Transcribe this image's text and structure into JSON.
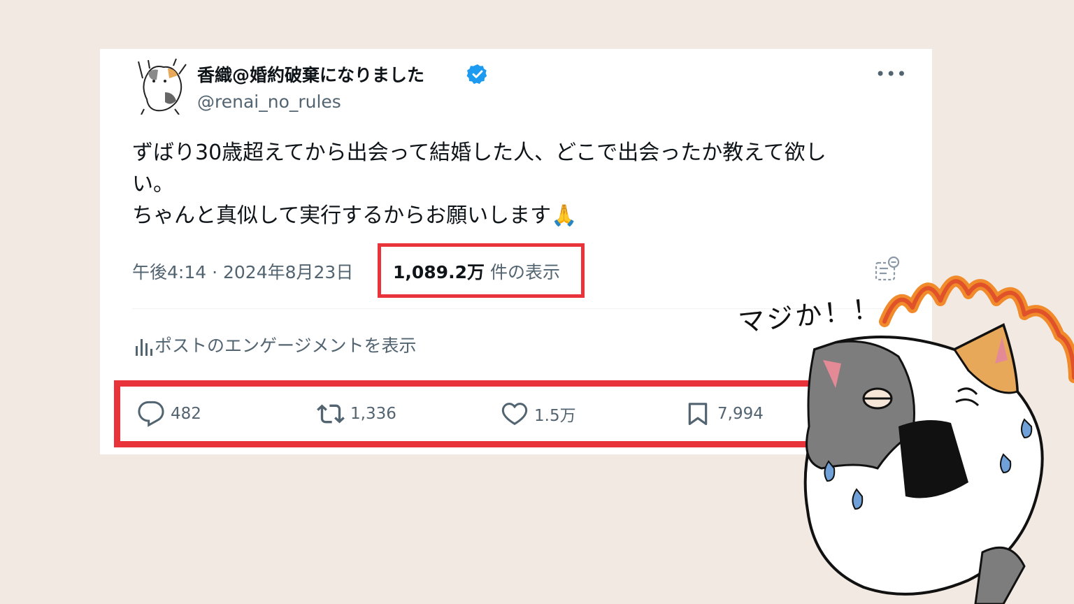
{
  "post": {
    "display_name": "香織@婚約破棄になりました",
    "handle": "@renai_no_rules",
    "text": "ずばり30歳超えてから出会って結婚した人、どこで出会ったか教えて欲し\nい。\nちゃんと真似して実行するからお願いします🙏",
    "timestamp": "午後4:14 · 2024年8月23日",
    "views_count": "1,089.2万",
    "views_label": "件の表示",
    "engagement_link": "ポストのエンゲージメントを表示",
    "more_icon": "•••",
    "actions": {
      "replies": "482",
      "reposts": "1,336",
      "likes": "1.5万",
      "bookmarks": "7,994"
    }
  },
  "overlay": {
    "speech_text": "マジか！！"
  },
  "colors": {
    "background": "#f2eae2",
    "highlight": "#e8333a",
    "verified": "#1d9bf0",
    "muted_text": "#536471"
  }
}
